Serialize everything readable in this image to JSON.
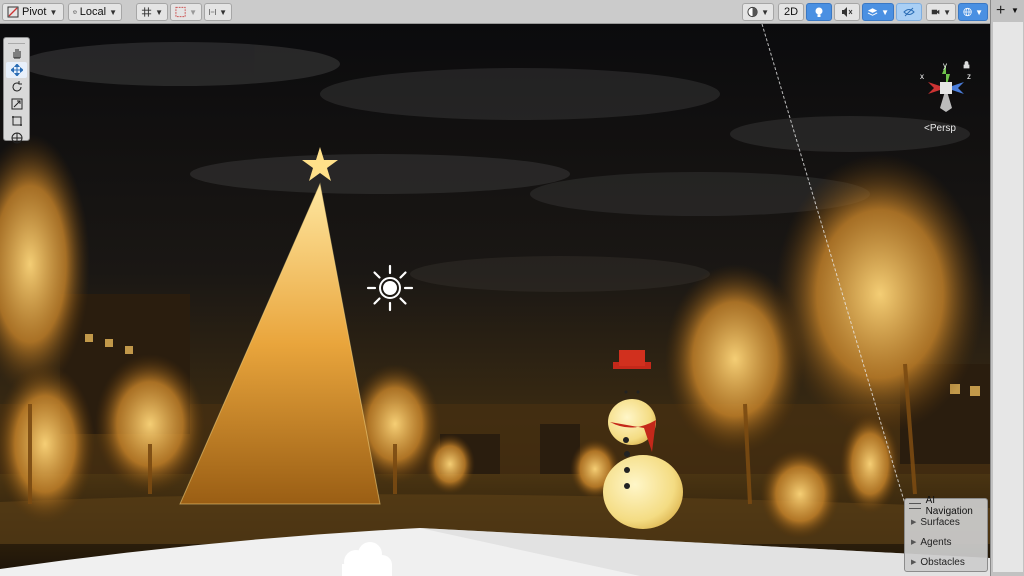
{
  "toolbar": {
    "pivot_label": "Pivot",
    "local_label": "Local",
    "mode_2d_label": "2D"
  },
  "tools": [
    "hand-tool",
    "move-tool",
    "rotate-tool",
    "scale-tool",
    "rect-tool",
    "transform-tool"
  ],
  "gizmo": {
    "view_label": "Persp",
    "axis_y": "y",
    "axis_x": "x",
    "axis_z": "z"
  },
  "ai_navigation": {
    "title": "AI Navigation",
    "items": [
      "Surfaces",
      "Agents",
      "Obstacles"
    ]
  },
  "colors": {
    "toolbar_bg": "#cbcbcb",
    "active_blue": "#4a90e2",
    "light_gold": "#f2b94a",
    "night_sky": "#0b0b0d"
  }
}
